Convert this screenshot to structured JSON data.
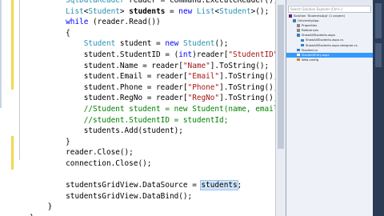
{
  "editor": {
    "lines": [
      {
        "tokens": [
          {
            "t": "        "
          },
          {
            "t": "SqlDataReader",
            "c": "ty"
          },
          {
            "t": " reader = command.ExecuteReader();"
          }
        ]
      },
      {
        "tokens": [
          {
            "t": "        "
          },
          {
            "t": "List",
            "c": "ty"
          },
          {
            "t": "<"
          },
          {
            "t": "Student",
            "c": "ty"
          },
          {
            "t": "> "
          },
          {
            "t": "students",
            "c": "bold"
          },
          {
            "t": " = "
          },
          {
            "t": "new",
            "c": "kw"
          },
          {
            "t": " "
          },
          {
            "t": "List",
            "c": "ty"
          },
          {
            "t": "<"
          },
          {
            "t": "Student",
            "c": "ty"
          },
          {
            "t": ">();"
          }
        ]
      },
      {
        "tokens": [
          {
            "t": "        "
          },
          {
            "t": "while",
            "c": "kw"
          },
          {
            "t": " (reader.Read())"
          }
        ]
      },
      {
        "tokens": [
          {
            "t": "        {"
          }
        ]
      },
      {
        "tokens": [
          {
            "t": "            "
          },
          {
            "t": "Student",
            "c": "ty"
          },
          {
            "t": " student = "
          },
          {
            "t": "new",
            "c": "kw"
          },
          {
            "t": " "
          },
          {
            "t": "Student",
            "c": "ty"
          },
          {
            "t": "();"
          }
        ]
      },
      {
        "tokens": [
          {
            "t": "            student.StudentID = ("
          },
          {
            "t": "int",
            "c": "kw"
          },
          {
            "t": ")reader["
          },
          {
            "t": "\"StudentID\"",
            "c": "str"
          },
          {
            "t": "];"
          }
        ]
      },
      {
        "tokens": [
          {
            "t": "            student.Name = reader["
          },
          {
            "t": "\"Name\"",
            "c": "str"
          },
          {
            "t": "].ToString();"
          }
        ]
      },
      {
        "tokens": [
          {
            "t": "            student.Email = reader["
          },
          {
            "t": "\"Email\"",
            "c": "str"
          },
          {
            "t": "].ToString();"
          }
        ]
      },
      {
        "tokens": [
          {
            "t": "            student.Phone = reader["
          },
          {
            "t": "\"Phone\"",
            "c": "str"
          },
          {
            "t": "].ToString();"
          }
        ]
      },
      {
        "tokens": [
          {
            "t": "            student.RegNo = reader["
          },
          {
            "t": "\"RegNo\"",
            "c": "str"
          },
          {
            "t": "].ToString();"
          }
        ]
      },
      {
        "tokens": [
          {
            "t": "            "
          },
          {
            "t": "//Student student = new Student(name, email, phone, r",
            "c": "cm"
          }
        ]
      },
      {
        "tokens": [
          {
            "t": "            "
          },
          {
            "t": "//student.StudentID = studentId;",
            "c": "cm"
          }
        ]
      },
      {
        "tokens": [
          {
            "t": "            students.Add(student);"
          }
        ]
      },
      {
        "tokens": [
          {
            "t": "        }"
          }
        ]
      },
      {
        "tokens": [
          {
            "t": "        reader.Close();"
          }
        ]
      },
      {
        "tokens": [
          {
            "t": "        connection.Close();"
          }
        ]
      },
      {
        "tokens": [
          {
            "t": ""
          }
        ]
      },
      {
        "tokens": [
          {
            "t": "        studentsGridView.DataSource = "
          },
          {
            "t": "students",
            "c": "hl"
          },
          {
            "t": ";"
          }
        ]
      },
      {
        "tokens": [
          {
            "t": "        studentsGridView.DataBind();"
          }
        ]
      },
      {
        "tokens": [
          {
            "t": "    }"
          }
        ]
      },
      {
        "tokens": [
          {
            "t": "}"
          }
        ]
      }
    ]
  },
  "solution_explorer": {
    "search_placeholder": "Search Solution Explorer (Ctrl+;)",
    "items": [
      {
        "label": "Solution 'StudentsApp' (1 project)",
        "indent": 0,
        "icon": "solution-icon",
        "color": "#68217a"
      },
      {
        "label": "UniversityApp",
        "indent": 1,
        "icon": "project-icon",
        "color": "#3b7fc4"
      },
      {
        "label": "Properties",
        "indent": 2,
        "icon": "wrench-icon",
        "color": "#8a8a8a"
      },
      {
        "label": "References",
        "indent": 2,
        "icon": "references-icon",
        "color": "#8a8a8a"
      },
      {
        "label": "ShowAllStudents.aspx",
        "indent": 2,
        "icon": "aspx-file-icon",
        "color": "#3b7fc4"
      },
      {
        "label": "ShowAllStudents.aspx.cs",
        "indent": 3,
        "icon": "cs-file-icon",
        "color": "#3b7fc4"
      },
      {
        "label": "ShowAllStudents.aspx.designer.cs",
        "indent": 3,
        "icon": "cs-file-icon",
        "color": "#3b7fc4"
      },
      {
        "label": "Student.cs",
        "indent": 2,
        "icon": "cs-file-icon",
        "color": "#3b7fc4"
      },
      {
        "label": "StudentEntry.aspx",
        "indent": 2,
        "icon": "aspx-file-icon",
        "color": "#ffffff",
        "selected": true
      },
      {
        "label": "Web.config",
        "indent": 2,
        "icon": "config-file-icon",
        "color": "#c58b1f"
      }
    ]
  }
}
